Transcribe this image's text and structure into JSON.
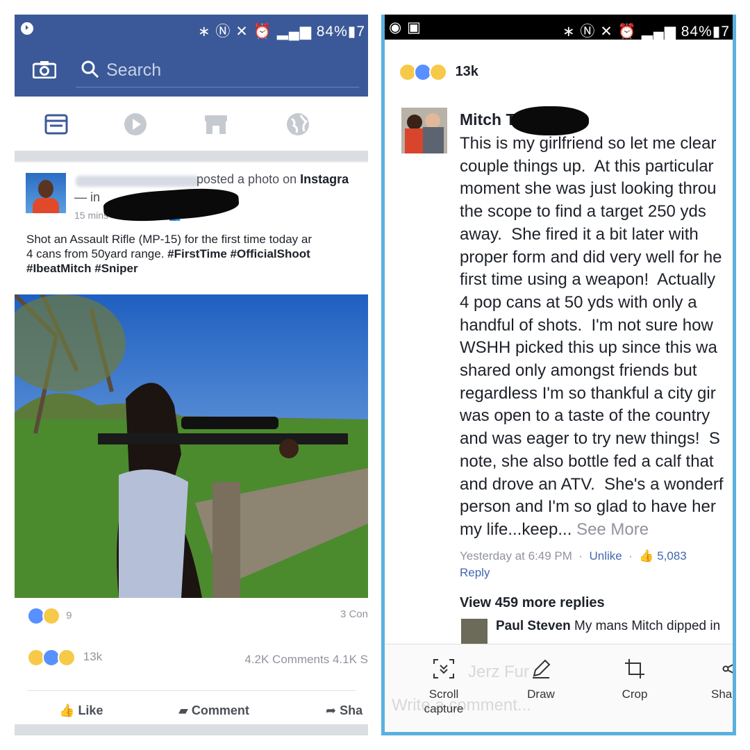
{
  "status_bar": {
    "text": "84%",
    "battery_tail": "7"
  },
  "left_panel": {
    "search": {
      "placeholder": "Search"
    },
    "post": {
      "header_action": "posted a photo on ",
      "header_target": "Instagra",
      "in_prefix": "— in",
      "meta": "15 mins · Instagram · ",
      "caption_line1": "Shot an Assault Rifle (MP-15) for the first time today ar",
      "caption_line2_plain": "4 cans from 50yard range. ",
      "caption_line2_tags": "#FirstTime #OfficialShoot",
      "caption_line3_tags": "#IbeatMitch #Sniper",
      "small_reaction_count": "9",
      "small_comment_count": "3 Con",
      "reaction_count": "13k",
      "comments_shares": "4.2K Comments 4.1K S",
      "actions": {
        "like": "Like",
        "comment": "Comment",
        "share": "Sha"
      }
    }
  },
  "right_panel": {
    "reaction_count": "13k",
    "comment": {
      "author": "Mitch T",
      "body_lines": [
        "This is my girlfriend so let me clear",
        "couple things up.  At this particular",
        "moment she was just looking throu",
        "the scope to find a target 250 yds",
        "away.  She fired it a bit later with",
        "proper form and did very well for he",
        "first time using a weapon!  Actually",
        "4 pop cans at 50 yds with only a",
        "handful of shots.  I'm not sure how",
        "WSHH picked this up since this wa",
        "shared only amongst friends but",
        "regardless I'm so thankful a city gir",
        "was open to a taste of the country",
        "and was eager to try new things!  S",
        "note, she also bottle fed a calf that",
        "and drove an ATV.  She's a wonderf",
        "person and I'm so glad to have her",
        "my life...keep... "
      ],
      "see_more": "See More",
      "timestamp": "Yesterday at 6:49 PM",
      "unlike": "Unlike",
      "like_count": "5,083",
      "reply": "Reply",
      "view_more": "View 459 more replies",
      "reply_author": "Paul Steven",
      "reply_text": " My mans Mitch dipped in",
      "ghost_name": "Jerz Fur",
      "ghost_input": "Write a comment..."
    },
    "toolbar": {
      "scroll_capture": "Scroll capture",
      "draw": "Draw",
      "crop": "Crop",
      "share": "Shar"
    }
  }
}
